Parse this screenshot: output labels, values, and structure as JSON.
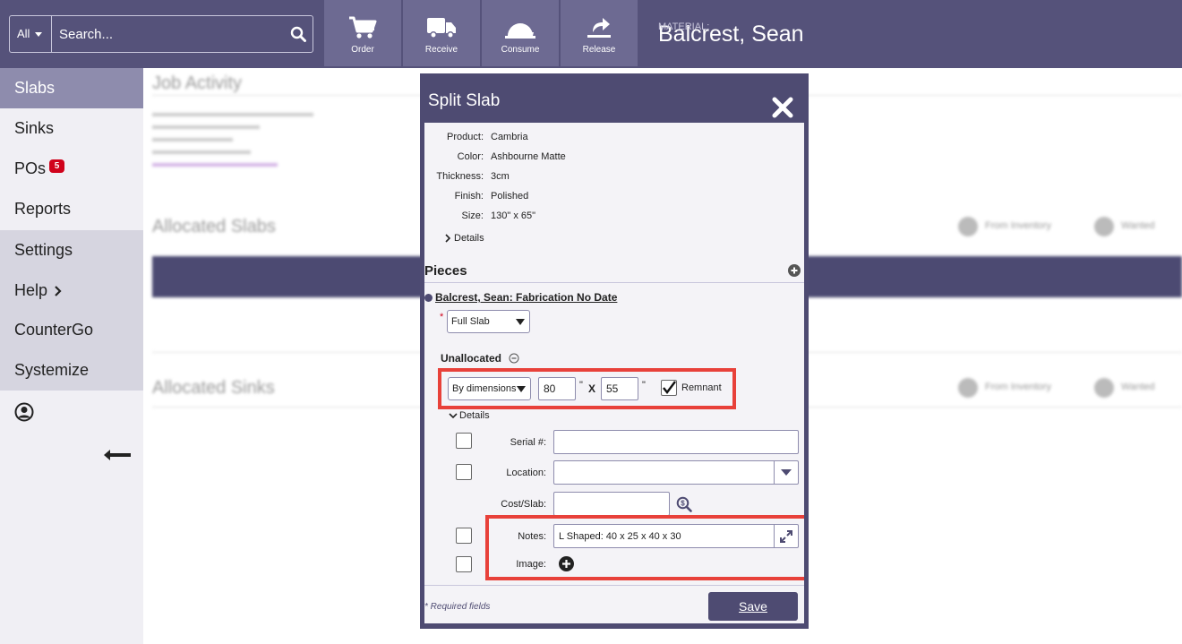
{
  "search": {
    "scope": "All",
    "placeholder": "Search..."
  },
  "toolbar": [
    {
      "label": "Order",
      "icon": "cart-icon"
    },
    {
      "label": "Receive",
      "icon": "truck-icon"
    },
    {
      "label": "Consume",
      "icon": "saw-blade-icon"
    },
    {
      "label": "Release",
      "icon": "release-icon"
    }
  ],
  "header": {
    "label": "MATERIAL:",
    "name": "Balcrest, Sean"
  },
  "sidebar": {
    "items": [
      {
        "label": "Slabs"
      },
      {
        "label": "Sinks"
      },
      {
        "label": "POs",
        "badge": "5"
      },
      {
        "label": "Reports"
      },
      {
        "label": "Settings"
      },
      {
        "label": "Help"
      },
      {
        "label": "CounterGo"
      },
      {
        "label": "Systemize"
      }
    ]
  },
  "background": {
    "job_activity": "Job Activity",
    "allocated_slabs": "Allocated Slabs",
    "allocated_sinks": "Allocated Sinks",
    "from_inventory": "From Inventory",
    "wanted": "Wanted"
  },
  "dialog": {
    "title": "Split Slab",
    "info": [
      {
        "key": "Product:",
        "value": "Cambria"
      },
      {
        "key": "Color:",
        "value": "Ashbourne Matte"
      },
      {
        "key": "Thickness:",
        "value": "3cm"
      },
      {
        "key": "Finish:",
        "value": "Polished"
      },
      {
        "key": "Size:",
        "value": "130\" x 65\""
      }
    ],
    "details_label": "Details",
    "pieces_heading": "Pieces",
    "job_link": "Balcrest, Sean: Fabrication No Date",
    "piece_type": "Full Slab",
    "unallocated_label": "Unallocated",
    "split_mode": "By dimensions",
    "width": "80",
    "height": "55",
    "inch_mark": "\"",
    "times": "X",
    "remnant_label": "Remnant",
    "fields": {
      "serial_label": "Serial #:",
      "location_label": "Location:",
      "cost_label": "Cost/Slab:",
      "notes_label": "Notes:",
      "notes_value": "L Shaped: 40 x 25 x 40 x 30",
      "image_label": "Image:"
    },
    "required_text": "* Required fields",
    "save_label": "Save"
  }
}
